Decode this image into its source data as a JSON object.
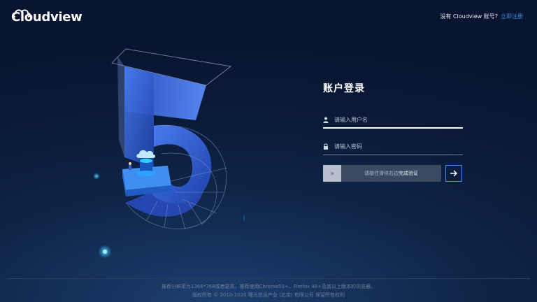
{
  "brand": {
    "logo_text": "Cloudview"
  },
  "header": {
    "no_account_text": "没有 Cloudview 账号?",
    "register_link": "立即注册"
  },
  "login": {
    "title": "账户登录",
    "username_placeholder": "请输入用户名",
    "password_placeholder": "请输入密码",
    "slider_prefix": "请按住滑块右边",
    "slider_strong": "完成验证",
    "slider_handle_glyph": "»",
    "submit_icon": "arrow-right-icon"
  },
  "footer": {
    "line1": "推荐分辨率为1366*768或者更高，推荐使用Chrome50+、Firefox 48+及其以上版本的浏览器。",
    "line2": "版权所有 © 2010-2020 曙光信息产业 (北京) 有限公司 保留所有权利"
  },
  "colors": {
    "accent": "#3a8ee6",
    "background": "#0a1a38"
  }
}
